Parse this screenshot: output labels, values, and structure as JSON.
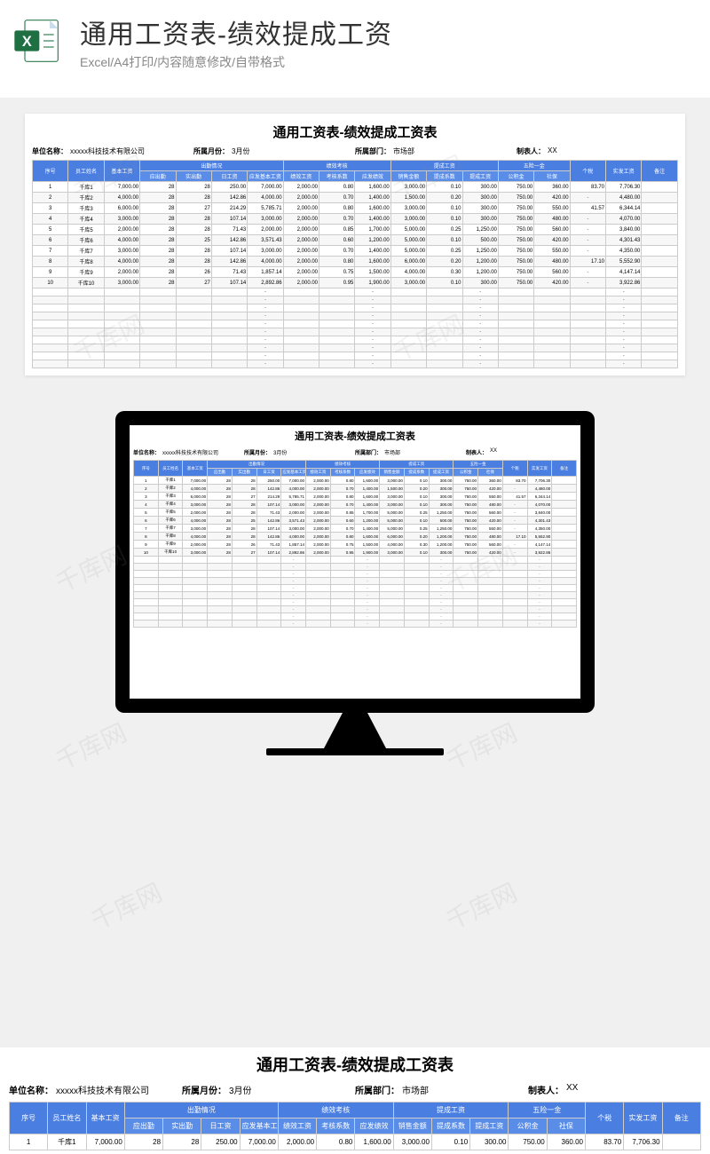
{
  "banner": {
    "title": "通用工资表-绩效提成工资",
    "subtitle": "Excel/A4打印/内容随意修改/自带格式"
  },
  "sheet": {
    "title": "通用工资表-绩效提成工资表",
    "meta": {
      "company_lbl": "单位名称：",
      "company": "xxxxx科技技术有限公司",
      "month_lbl": "所属月份：",
      "month": "3月份",
      "dept_lbl": "所属部门：",
      "dept": "市场部",
      "maker_lbl": "制表人：",
      "maker": "XX"
    },
    "head_top": [
      "序号",
      "员工姓名",
      "基本工资",
      "出勤情况",
      "",
      "",
      "",
      "绩效考核",
      "",
      "",
      "提成工资",
      "",
      "",
      "五险一金",
      "",
      "个税",
      "实发工资",
      "备注"
    ],
    "head_sub": [
      "",
      "",
      "",
      "应出勤",
      "实出勤",
      "日工资",
      "应发基本工资",
      "绩效工资",
      "考核系数",
      "应发绩效",
      "销售金额",
      "提成系数",
      "提成工资",
      "公积金",
      "社保",
      "",
      "",
      ""
    ],
    "span_top": [
      1,
      1,
      1,
      4,
      0,
      0,
      0,
      3,
      0,
      0,
      3,
      0,
      0,
      2,
      0,
      1,
      1,
      1
    ],
    "rows": [
      [
        "1",
        "千库1",
        "7,000.00",
        "28",
        "28",
        "250.00",
        "7,000.00",
        "2,000.00",
        "0.80",
        "1,600.00",
        "3,000.00",
        "0.10",
        "300.00",
        "750.00",
        "360.00",
        "83.70",
        "7,706.30",
        ""
      ],
      [
        "2",
        "千库2",
        "4,000.00",
        "28",
        "28",
        "142.86",
        "4,000.00",
        "2,000.00",
        "0.70",
        "1,400.00",
        "1,500.00",
        "0.20",
        "300.00",
        "750.00",
        "420.00",
        "-",
        "4,480.00",
        ""
      ],
      [
        "3",
        "千库3",
        "6,000.00",
        "28",
        "27",
        "214.29",
        "5,785.71",
        "2,000.00",
        "0.80",
        "1,600.00",
        "3,000.00",
        "0.10",
        "300.00",
        "750.00",
        "550.00",
        "41.57",
        "6,344.14",
        ""
      ],
      [
        "4",
        "千库4",
        "3,000.00",
        "28",
        "28",
        "107.14",
        "3,000.00",
        "2,000.00",
        "0.70",
        "1,400.00",
        "3,000.00",
        "0.10",
        "300.00",
        "750.00",
        "480.00",
        "-",
        "4,070.00",
        ""
      ],
      [
        "5",
        "千库5",
        "2,000.00",
        "28",
        "28",
        "71.43",
        "2,000.00",
        "2,000.00",
        "0.85",
        "1,700.00",
        "5,000.00",
        "0.25",
        "1,250.00",
        "750.00",
        "560.00",
        "-",
        "3,840.00",
        ""
      ],
      [
        "6",
        "千库6",
        "4,000.00",
        "28",
        "25",
        "142.86",
        "3,571.43",
        "2,000.00",
        "0.60",
        "1,200.00",
        "5,000.00",
        "0.10",
        "500.00",
        "750.00",
        "420.00",
        "-",
        "4,301.43",
        ""
      ],
      [
        "7",
        "千库7",
        "3,000.00",
        "28",
        "28",
        "107.14",
        "3,000.00",
        "2,000.00",
        "0.70",
        "1,400.00",
        "5,000.00",
        "0.25",
        "1,250.00",
        "750.00",
        "550.00",
        "-",
        "4,350.00",
        ""
      ],
      [
        "8",
        "千库8",
        "4,000.00",
        "28",
        "28",
        "142.86",
        "4,000.00",
        "2,000.00",
        "0.80",
        "1,600.00",
        "6,000.00",
        "0.20",
        "1,200.00",
        "750.00",
        "480.00",
        "17.10",
        "5,552.90",
        ""
      ],
      [
        "9",
        "千库9",
        "2,000.00",
        "28",
        "26",
        "71.43",
        "1,857.14",
        "2,000.00",
        "0.75",
        "1,500.00",
        "4,000.00",
        "0.30",
        "1,200.00",
        "750.00",
        "560.00",
        "-",
        "4,147.14",
        ""
      ],
      [
        "10",
        "千库10",
        "3,000.00",
        "28",
        "27",
        "107.14",
        "2,892.86",
        "2,000.00",
        "0.95",
        "1,900.00",
        "3,000.00",
        "0.10",
        "300.00",
        "750.00",
        "420.00",
        "-",
        "3,922.86",
        ""
      ]
    ],
    "empty_rows": 10,
    "watermark": "千库网"
  }
}
